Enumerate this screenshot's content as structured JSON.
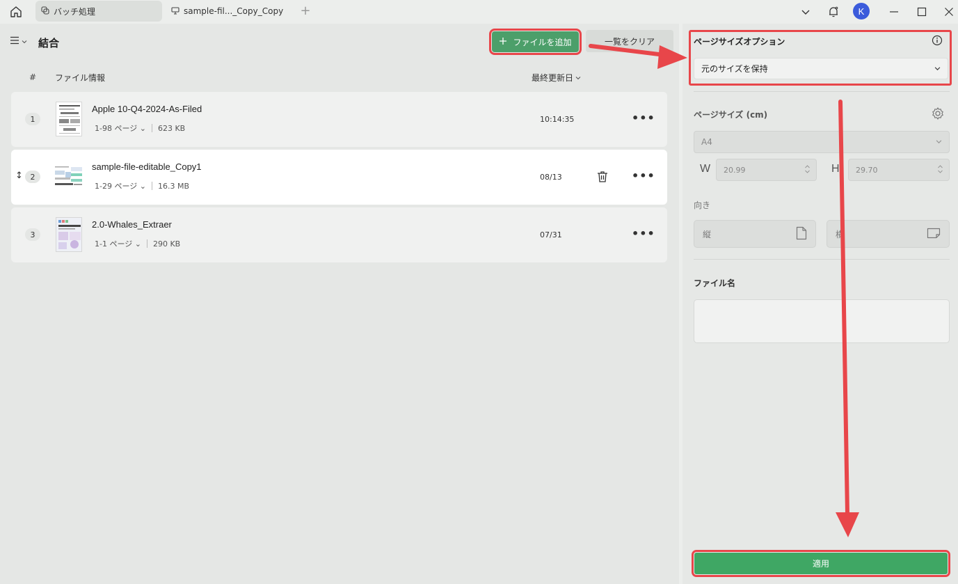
{
  "titlebar": {
    "tabs": [
      {
        "label": "バッチ処理",
        "icon": "batch-icon"
      },
      {
        "label": "sample-fil..._Copy_Copy",
        "icon": "monitor-icon"
      }
    ],
    "avatar_initial": "K"
  },
  "main": {
    "title": "結合",
    "add_button": "ファイルを追加",
    "clear_button": "一覧をクリア",
    "columns": {
      "index": "#",
      "info": "ファイル情報",
      "modified": "最終更新日"
    },
    "files": [
      {
        "index": "1",
        "name": "Apple 10-Q4-2024-As-Filed",
        "pages": "1-98 ページ",
        "size": "623 KB",
        "date": "10:14:35"
      },
      {
        "index": "2",
        "name": "sample-file-editable_Copy1",
        "pages": "1-29 ページ",
        "size": "16.3 MB",
        "date": "08/13"
      },
      {
        "index": "3",
        "name": "2.0-Whales_Extraer",
        "pages": "1-1 ページ",
        "size": "290 KB",
        "date": "07/31"
      }
    ]
  },
  "panel": {
    "page_size_option_label": "ページサイズオプション",
    "page_size_option_value": "元のサイズを保持",
    "page_size_label": "ページサイズ (cm)",
    "paper_value": "A4",
    "width_letter": "W",
    "width_value": "20.99",
    "height_letter": "H",
    "height_value": "29.70",
    "orientation_label": "向き",
    "portrait_label": "縦",
    "landscape_label": "横",
    "file_name_label": "ファイル名",
    "file_name_value": "",
    "apply_button": "適用"
  },
  "colors": {
    "accent_green": "#4c9f6a",
    "annotation_red": "#e8464a",
    "avatar_blue": "#3b5bdb"
  }
}
